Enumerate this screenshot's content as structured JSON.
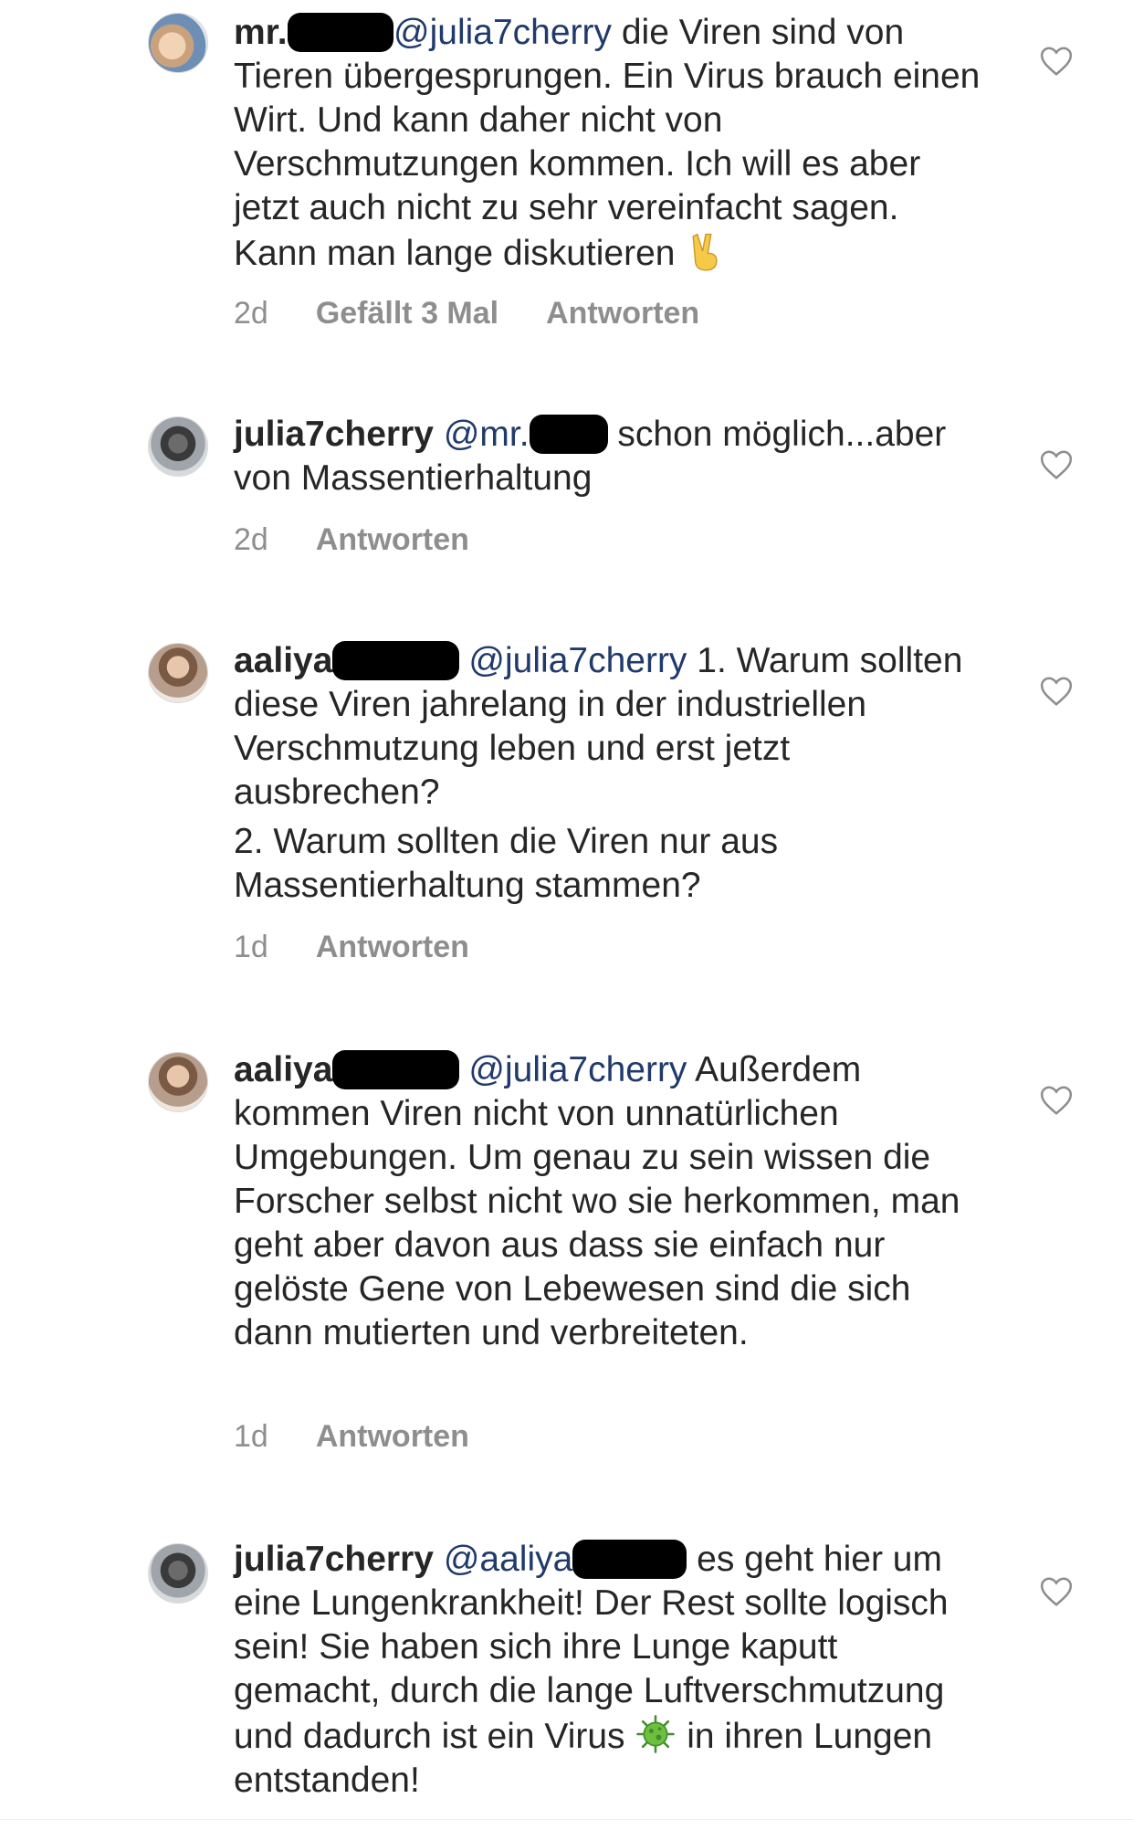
{
  "comments": [
    {
      "username_visible": "mr.",
      "username_redacted": "xxxxx",
      "mention": "@julia7cherry",
      "text": " die Viren sind von Tieren übergesprungen. Ein Virus brauch einen Wirt. Und kann daher nicht von Verschmutzungen kommen. Ich will es aber jetzt auch nicht zu sehr vereinfacht sagen. Kann man lange diskutieren ",
      "emoji": "victory-hand",
      "time": "2d",
      "likes": "Gefällt 3 Mal",
      "reply": "Antworten"
    },
    {
      "username": "julia7cherry",
      "mention_visible": "@mr.",
      "mention_redacted": "xxxx",
      "text": " schon möglich...aber von Massentierhaltung",
      "time": "2d",
      "reply": "Antworten"
    },
    {
      "username_visible": "aaliya",
      "username_redacted": "xxxxxx",
      "mention": "@julia7cherry",
      "text": " 1. Warum sollten diese Viren jahrelang in der industriellen Verschmutzung leben und erst jetzt ausbrechen?",
      "text2": "2. Warum sollten die Viren nur aus Massentierhaltung stammen?",
      "time": "1d",
      "reply": "Antworten"
    },
    {
      "username_visible": "aaliya",
      "username_redacted": "xxxxxx",
      "mention": "@julia7cherry",
      "text": " Außerdem kommen Viren nicht von unnatürlichen Umgebungen. Um genau zu sein wissen die Forscher selbst nicht wo sie herkommen, man geht aber davon aus dass sie einfach nur gelöste Gene von Lebewesen sind die sich dann mutierten und verbreiteten.",
      "time": "1d",
      "reply": "Antworten"
    },
    {
      "username": "julia7cherry",
      "mention_visible": "@aaliya",
      "mention_redacted": "xxxxxx",
      "text": " es geht hier um eine Lungenkrankheit! Der Rest sollte logisch sein! Sie haben sich ihre Lunge kaputt gemacht, durch die lange Luftverschmutzung und dadurch ist ein Virus ",
      "emoji": "microbe",
      "text_end": " in ihren Lungen entstanden!"
    }
  ],
  "colors": {
    "text": "#262626",
    "mention": "#203a6b",
    "meta": "#8e8e8e"
  }
}
